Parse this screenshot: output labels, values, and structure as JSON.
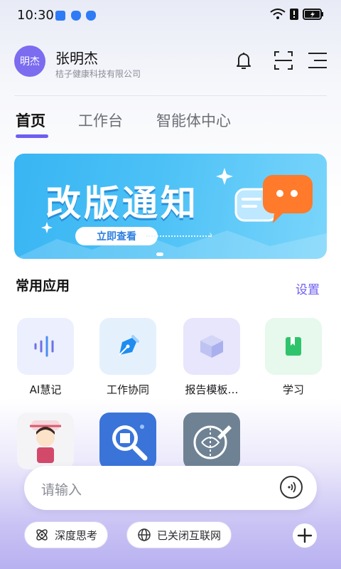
{
  "status": {
    "time": "10:30"
  },
  "user": {
    "avatar_text": "明杰",
    "name": "张明杰",
    "company": "桔子健康科技有限公司"
  },
  "tabs": [
    {
      "label": "首页",
      "active": true
    },
    {
      "label": "工作台",
      "active": false
    },
    {
      "label": "智能体中心",
      "active": false
    }
  ],
  "banner": {
    "title": "改版通知",
    "button": "立即查看"
  },
  "section": {
    "title": "常用应用",
    "link": "设置"
  },
  "apps": [
    {
      "label": "AI慧记",
      "icon": "voice-wave-icon",
      "bg": "#eceffd"
    },
    {
      "label": "工作协同",
      "icon": "pen-nib-icon",
      "bg": "#e4f1fd"
    },
    {
      "label": "报告模板…",
      "icon": "cube-icon",
      "bg": "#e7e6fc"
    },
    {
      "label": "学习",
      "icon": "book-icon",
      "bg": "#e7f8ec"
    },
    {
      "label": "",
      "icon": "cartoon-avatar-icon",
      "bg": "#f4f4f6"
    },
    {
      "label": "",
      "icon": "medicine-search-icon",
      "bg": "#3a74d9"
    },
    {
      "label": "",
      "icon": "brain-pen-icon",
      "bg": "#6f8294"
    }
  ],
  "input": {
    "placeholder": "请输入"
  },
  "chips": {
    "deep_think": "深度思考",
    "internet": "已关闭互联网"
  },
  "colors": {
    "accent": "#6e5ff0",
    "banner": "#38b5f3"
  }
}
